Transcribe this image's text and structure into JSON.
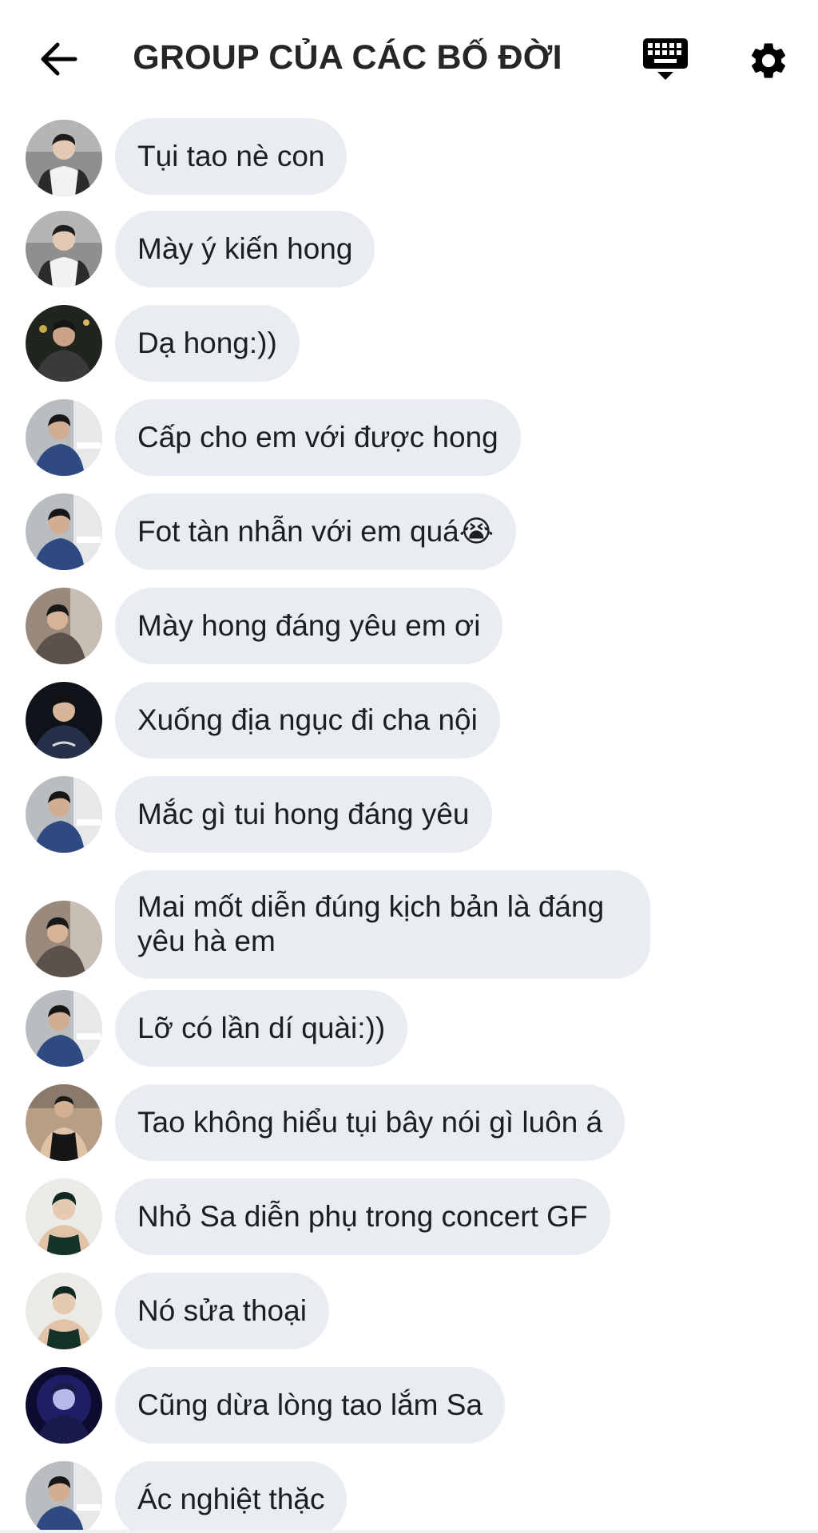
{
  "header": {
    "title": "GROUP CỦA CÁC BỐ ĐỜI",
    "back_icon": "arrow-left-icon",
    "keyboard_icon": "keyboard-icon",
    "settings_icon": "gear-icon"
  },
  "messages": [
    {
      "text": "Tụi tao nè con",
      "avatar": "a"
    },
    {
      "text": "Mày ý kiến hong",
      "avatar": "a"
    },
    {
      "text": "Dạ hong:))",
      "avatar": "b"
    },
    {
      "text": "Cấp cho em với được hong",
      "avatar": "c"
    },
    {
      "text": "Fot tàn nhẫn với em quá😭",
      "avatar": "c"
    },
    {
      "text": "Mày hong đáng yêu em ơi",
      "avatar": "d"
    },
    {
      "text": "Xuống địa ngục đi cha nội",
      "avatar": "e"
    },
    {
      "text": "Mắc gì tui hong đáng yêu",
      "avatar": "c"
    },
    {
      "text": "Mai mốt diễn đúng kịch bản là đáng yêu hà em",
      "avatar": "d"
    },
    {
      "text": "Lỡ có lần dí quài:))",
      "avatar": "c"
    },
    {
      "text": "Tao không hiểu tụi bây nói gì luôn á",
      "avatar": "f"
    },
    {
      "text": "Nhỏ Sa diễn phụ trong concert GF",
      "avatar": "g"
    },
    {
      "text": "Nó sửa thoại",
      "avatar": "g"
    },
    {
      "text": "Cũng dừa lòng tao lắm Sa",
      "avatar": "h"
    },
    {
      "text": "Ác nghiệt thặc",
      "avatar": "c"
    }
  ],
  "colors": {
    "bubble": "#e9ecf1",
    "text": "#1c1e21",
    "header_text": "#262626",
    "background": "#ffffff"
  }
}
